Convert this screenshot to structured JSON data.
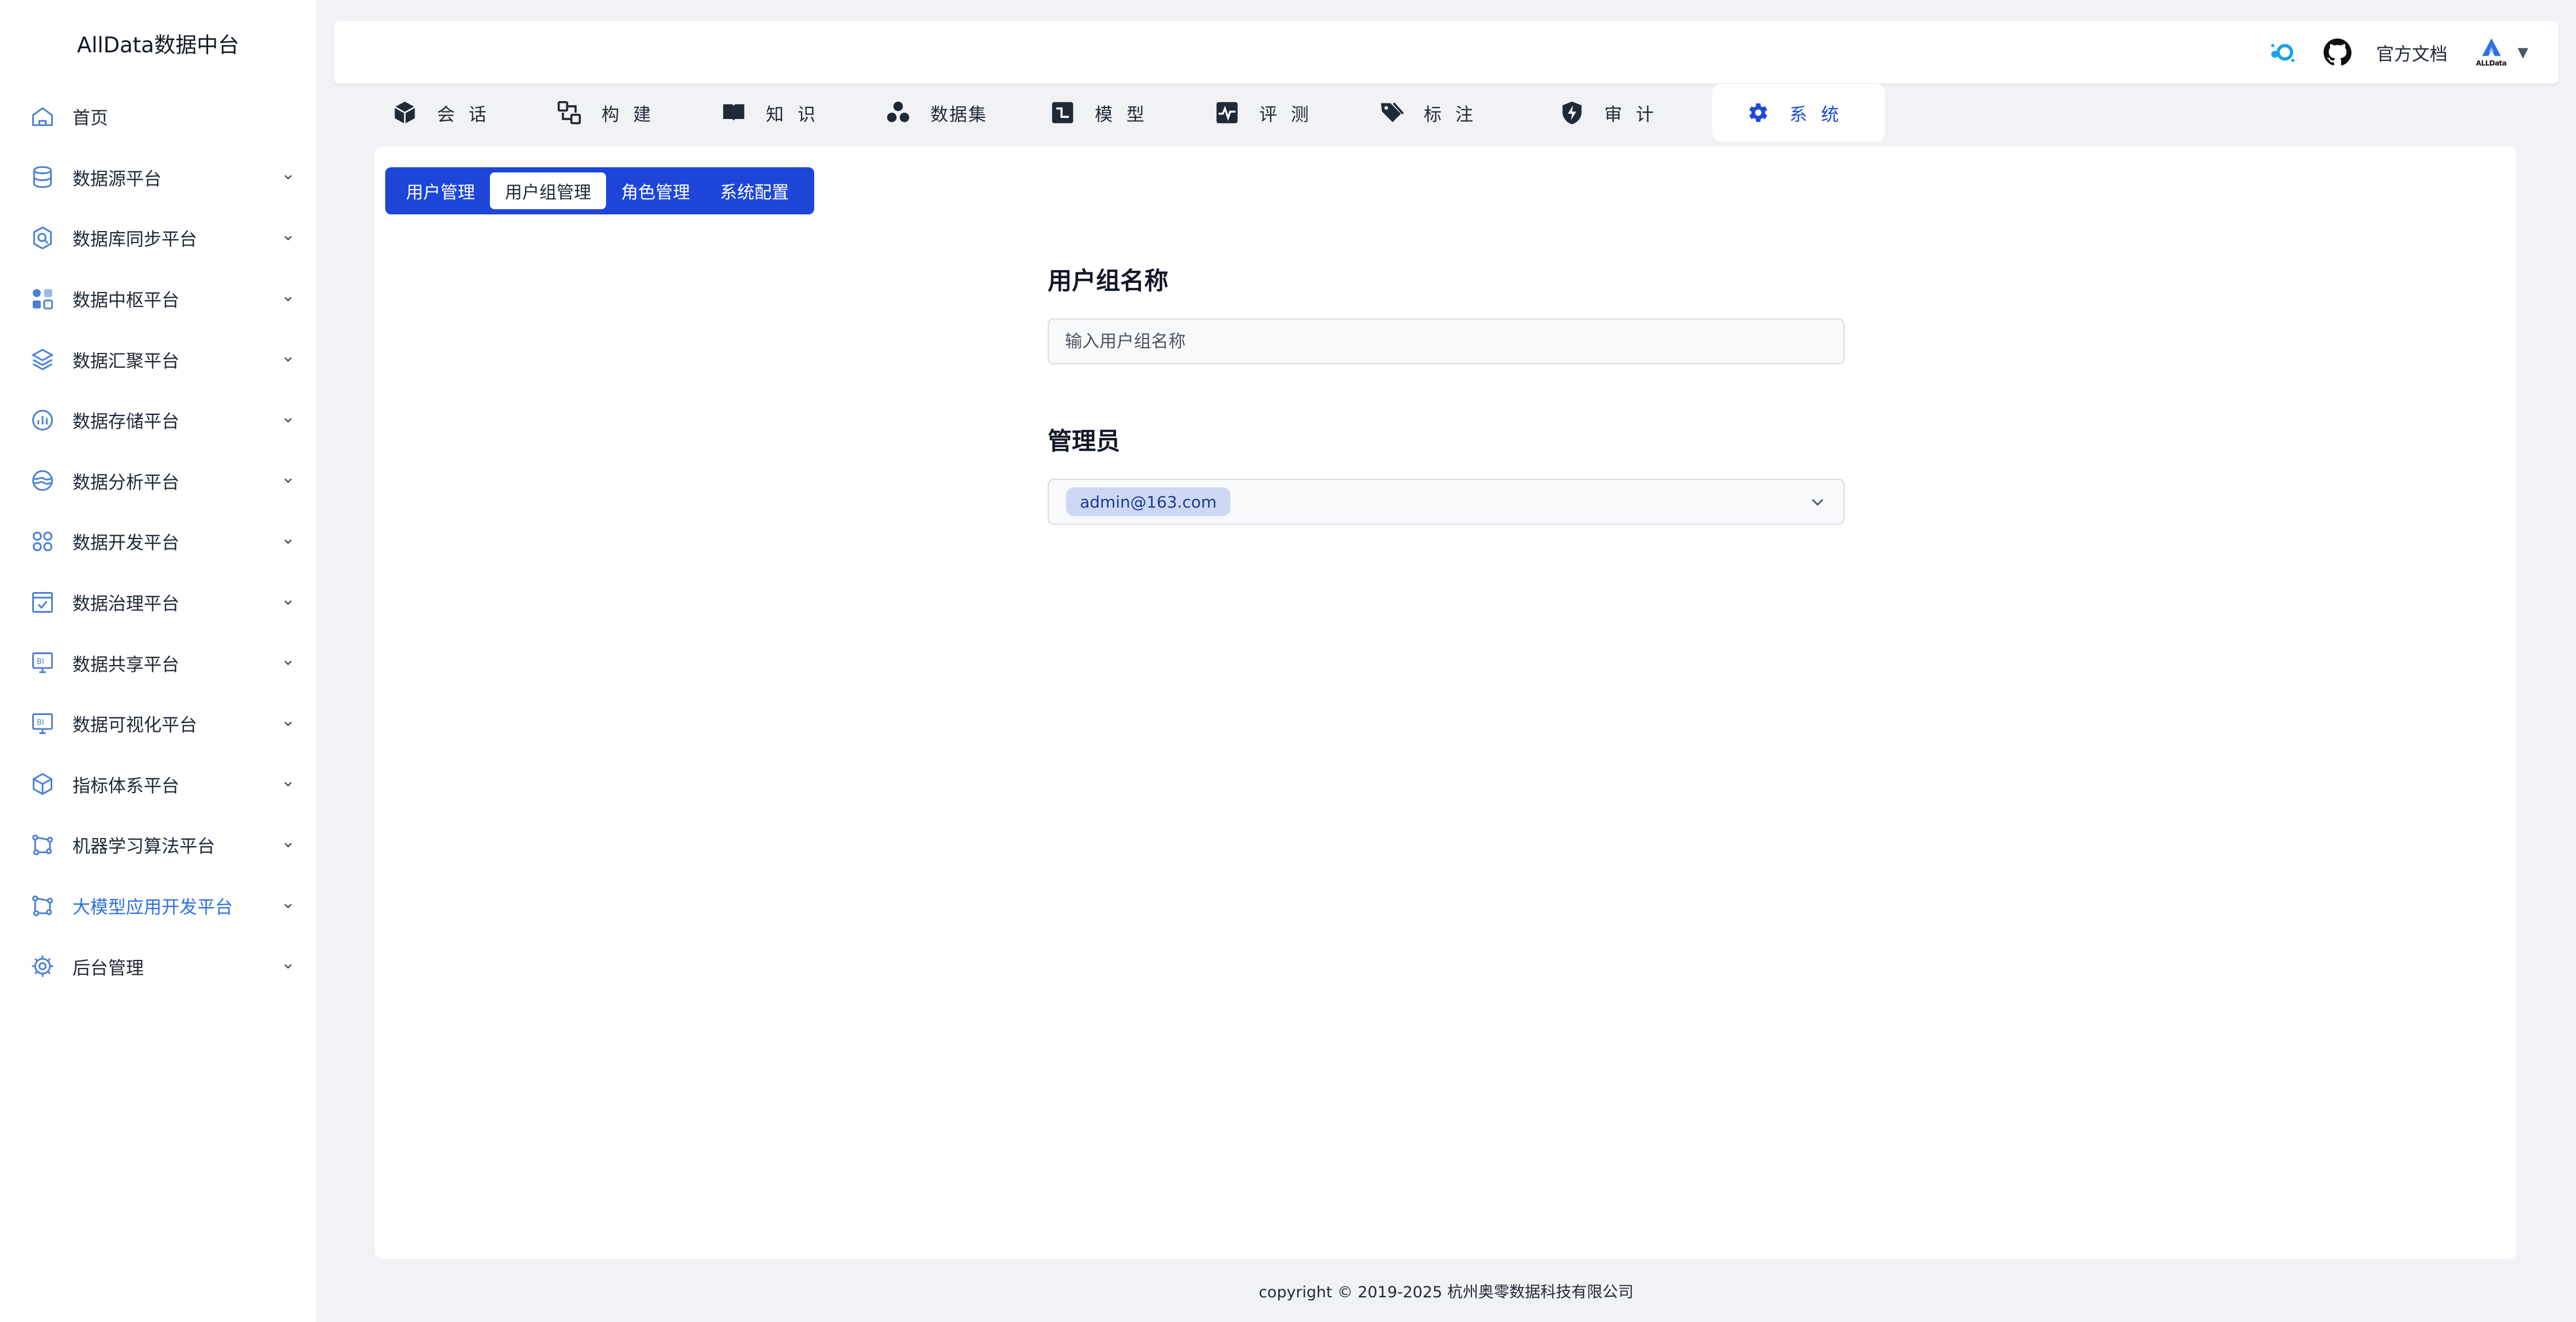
{
  "app": {
    "title": "AllData数据中台"
  },
  "sidebar": {
    "items": [
      {
        "label": "首页",
        "icon": "home-icon"
      },
      {
        "label": "数据源平台",
        "icon": "database-icon"
      },
      {
        "label": "数据库同步平台",
        "icon": "sync-icon"
      },
      {
        "label": "数据中枢平台",
        "icon": "grid-icon"
      },
      {
        "label": "数据汇聚平台",
        "icon": "layers-icon"
      },
      {
        "label": "数据存储平台",
        "icon": "storage-chart-icon"
      },
      {
        "label": "数据分析平台",
        "icon": "analysis-icon"
      },
      {
        "label": "数据开发平台",
        "icon": "cluster-icon"
      },
      {
        "label": "数据治理平台",
        "icon": "governance-icon"
      },
      {
        "label": "数据共享平台",
        "icon": "bi-monitor-icon"
      },
      {
        "label": "数据可视化平台",
        "icon": "bi-monitor-icon"
      },
      {
        "label": "指标体系平台",
        "icon": "cube-icon"
      },
      {
        "label": "机器学习算法平台",
        "icon": "ml-icon"
      },
      {
        "label": "大模型应用开发平台",
        "icon": "ml-icon",
        "active": true
      },
      {
        "label": "后台管理",
        "icon": "admin-gear-icon"
      }
    ]
  },
  "header": {
    "docs_label": "官方文档",
    "logo_text": "ALLData",
    "caret": "▼"
  },
  "module_tabs": [
    {
      "label": "会话",
      "icon": "cube-solid-icon"
    },
    {
      "label": "构建",
      "icon": "build-icon"
    },
    {
      "label": "知识",
      "icon": "book-icon"
    },
    {
      "label": "数据集",
      "icon": "dataset-icon"
    },
    {
      "label": "模型",
      "icon": "model-icon"
    },
    {
      "label": "评测",
      "icon": "pulse-icon"
    },
    {
      "label": "标注",
      "icon": "tags-icon"
    },
    {
      "label": "审计",
      "icon": "shield-bolt-icon"
    },
    {
      "label": "系统",
      "icon": "gear-solid-icon",
      "active": true
    }
  ],
  "subtabs": [
    {
      "label": "用户管理"
    },
    {
      "label": "用户组管理",
      "active": true
    },
    {
      "label": "角色管理"
    },
    {
      "label": "系统配置"
    }
  ],
  "form": {
    "group_name_label": "用户组名称",
    "group_name_placeholder": "输入用户组名称",
    "group_name_value": "",
    "admin_label": "管理员",
    "admin_selected": "admin@163.com"
  },
  "footer": {
    "copyright": "copyright © 2019-2025 杭州奥零数据科技有限公司"
  },
  "colors": {
    "accent": "#1d46d9",
    "active_text": "#2f6fe4",
    "background": "#f0f2f5"
  }
}
